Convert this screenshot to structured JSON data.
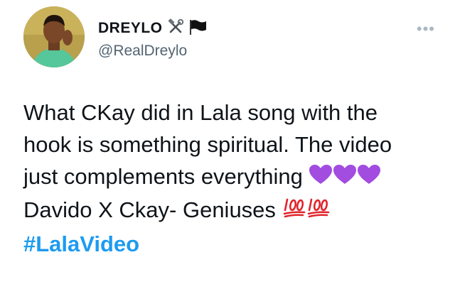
{
  "tweet": {
    "author": {
      "display_name": "DREYLO",
      "handle": "@RealDreylo",
      "name_emojis": [
        "hammer-and-wrench-icon",
        "black-flag-icon"
      ]
    },
    "more_label": "•••",
    "body": {
      "line1": "What CKay did in Lala song with the",
      "line2": "hook is something spiritual. The video",
      "line3": "just complements everything",
      "line4": "Davido X Ckay- Geniuses",
      "hashtag": "#LalaVideo"
    },
    "colors": {
      "hashtag": "#1d9bf0",
      "handle": "#536471",
      "heart": "#a24ce0",
      "hundred": "#e0242b"
    }
  }
}
